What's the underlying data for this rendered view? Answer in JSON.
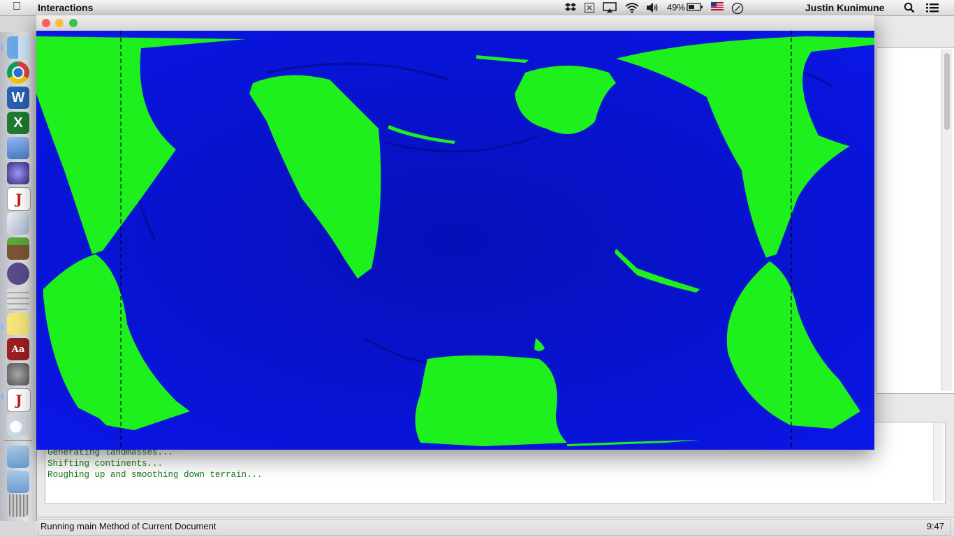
{
  "menubar": {
    "app_name": "Interactions",
    "battery_percent": "49%",
    "user_name": "Justin Kunimune",
    "icons": [
      "apple-icon",
      "dropbox-icon",
      "x-box-icon",
      "airplay-icon",
      "wifi-icon",
      "volume-icon",
      "battery-icon",
      "flag-icon",
      "clock-icon",
      "spotlight-icon",
      "list-icon"
    ]
  },
  "dock": {
    "apps": [
      "finder",
      "chrome",
      "word",
      "excel",
      "keynote",
      "imovie",
      "jgrasp",
      "activity-monitor",
      "minecraft",
      "github",
      "calculator",
      "stickies",
      "dictionary",
      "system-preferences",
      "jgrasp-2",
      "java",
      "applications-folder",
      "downloads-folder",
      "trash"
    ],
    "labels": {
      "word": "W",
      "excel": "X",
      "jgrasp": "J",
      "jgrasp-2": "J",
      "dictionary": "Aa"
    }
  },
  "console": {
    "lines": [
      "Generating landmasses...",
      "Shifting continents...",
      "Roughing up and smoothing down terrain..."
    ]
  },
  "statusbar": {
    "message": "Running main Method of Current Document",
    "time": "9:47"
  },
  "window": {
    "colors": {
      "ocean": "#0a14e6",
      "ocean_deep": "#0610b0",
      "land": "#1ef01e",
      "close": "#fc605c",
      "minimize": "#fdbc40",
      "zoom": "#34c84a"
    }
  }
}
